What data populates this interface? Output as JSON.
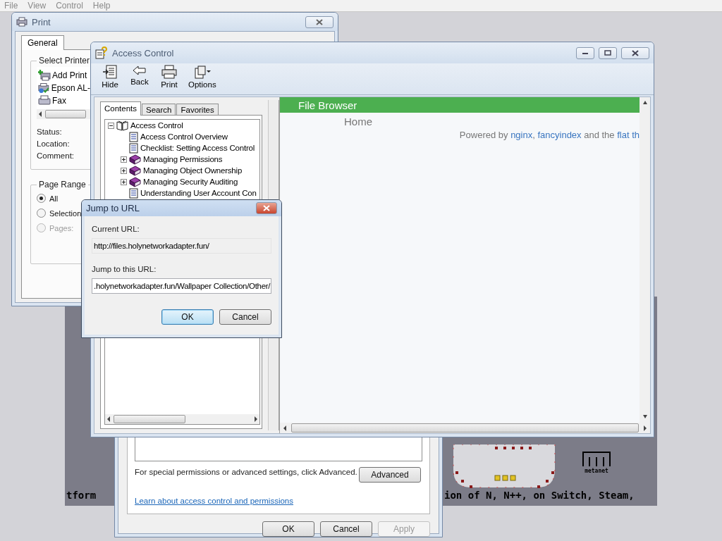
{
  "menu_bar": [
    "File",
    "View",
    "Control",
    "Help"
  ],
  "backdrop": {
    "texts": [
      "tform",
      "ion of N, N++, on Switch, Steam,"
    ],
    "logo_label": "metanet"
  },
  "print_window": {
    "title": "Print",
    "tabs": [
      {
        "label": "General",
        "selected": true
      }
    ],
    "select_printer": {
      "label": "Select Printer",
      "printers": [
        {
          "name": "Add Print"
        },
        {
          "name": "Epson AL-"
        },
        {
          "name": "Fax"
        }
      ]
    },
    "info_labels": [
      "Status:",
      "Location:",
      "Comment:"
    ],
    "page_range": {
      "label": "Page Range",
      "options": [
        {
          "label": "All",
          "selected": true,
          "disabled": false
        },
        {
          "label": "Selection",
          "selected": false,
          "disabled": false
        },
        {
          "label": "Pages:",
          "selected": false,
          "disabled": true
        }
      ]
    }
  },
  "security_window": {
    "note": "For special permissions or advanced settings, click Advanced.",
    "advanced_button": "Advanced",
    "link": "Learn about access control and permissions",
    "buttons": [
      {
        "label": "OK",
        "disabled": false
      },
      {
        "label": "Cancel",
        "disabled": false
      },
      {
        "label": "Apply",
        "disabled": true
      }
    ]
  },
  "help_window": {
    "title": "Access Control",
    "toolbar": [
      {
        "label": "Hide"
      },
      {
        "label": "Back"
      },
      {
        "label": "Print"
      },
      {
        "label": "Options"
      }
    ],
    "nav_tabs": [
      {
        "label": "Contents",
        "selected": true
      },
      {
        "label": "Search",
        "selected": false
      },
      {
        "label": "Favorites",
        "selected": false
      }
    ],
    "tree": [
      {
        "label": "Access Control",
        "kind": "book",
        "expanded": true,
        "children": [
          {
            "label": "Access Control Overview",
            "kind": "page"
          },
          {
            "label": "Checklist: Setting Access Control",
            "kind": "page"
          },
          {
            "label": "Managing Permissions",
            "kind": "book",
            "expanded": false
          },
          {
            "label": "Managing Object Ownership",
            "kind": "book",
            "expanded": false
          },
          {
            "label": "Managing Security Auditing",
            "kind": "book",
            "expanded": false
          },
          {
            "label": "Understanding User Account Con",
            "kind": "page"
          }
        ]
      }
    ],
    "page": {
      "header": "File Browser",
      "crumb": "Home",
      "powered_by": [
        {
          "kind": "text",
          "text": "Powered by "
        },
        {
          "kind": "link",
          "text": "nginx"
        },
        {
          "kind": "text",
          "text": ", "
        },
        {
          "kind": "link",
          "text": "fancyindex"
        },
        {
          "kind": "text",
          "text": " and the "
        },
        {
          "kind": "link",
          "text": "flat th"
        }
      ]
    }
  },
  "jump_dialog": {
    "title": "Jump to URL",
    "current_label": "Current URL:",
    "current_url": "http://files.holynetworkadapter.fun/",
    "jump_label": "Jump to this URL:",
    "jump_url": ".holynetworkadapter.fun/Wallpaper Collection/Other/",
    "buttons": [
      {
        "label": "OK",
        "default": true
      },
      {
        "label": "Cancel",
        "default": false
      }
    ]
  }
}
